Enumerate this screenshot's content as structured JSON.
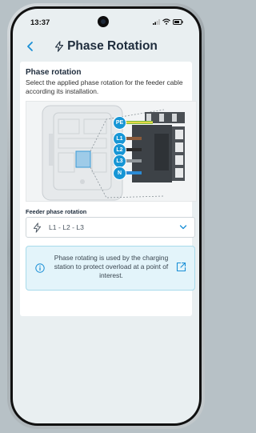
{
  "status_bar": {
    "time": "13:37"
  },
  "header": {
    "title": "Phase Rotation",
    "back_icon": "chevron-left-icon",
    "title_icon": "bolt-icon"
  },
  "card": {
    "heading": "Phase rotation",
    "description": "Select the applied phase rotation for the feeder cable according its installation.",
    "diagram": {
      "terminals": [
        "PE",
        "L1",
        "L2",
        "L3",
        "N"
      ]
    },
    "field_label": "Feeder phase rotation",
    "select": {
      "value": "L1 - L2 - L3",
      "icon": "bolt-icon"
    },
    "info": {
      "text": "Phase rotating is used by the charging station to protect overload at a point of interest.",
      "icon": "info-icon",
      "link_icon": "external-link-icon"
    }
  },
  "colors": {
    "accent": "#1a8fd6",
    "terminal_badge": "#1796d5",
    "info_bg": "#e3f4fa",
    "screen_bg": "#e9eff1"
  }
}
